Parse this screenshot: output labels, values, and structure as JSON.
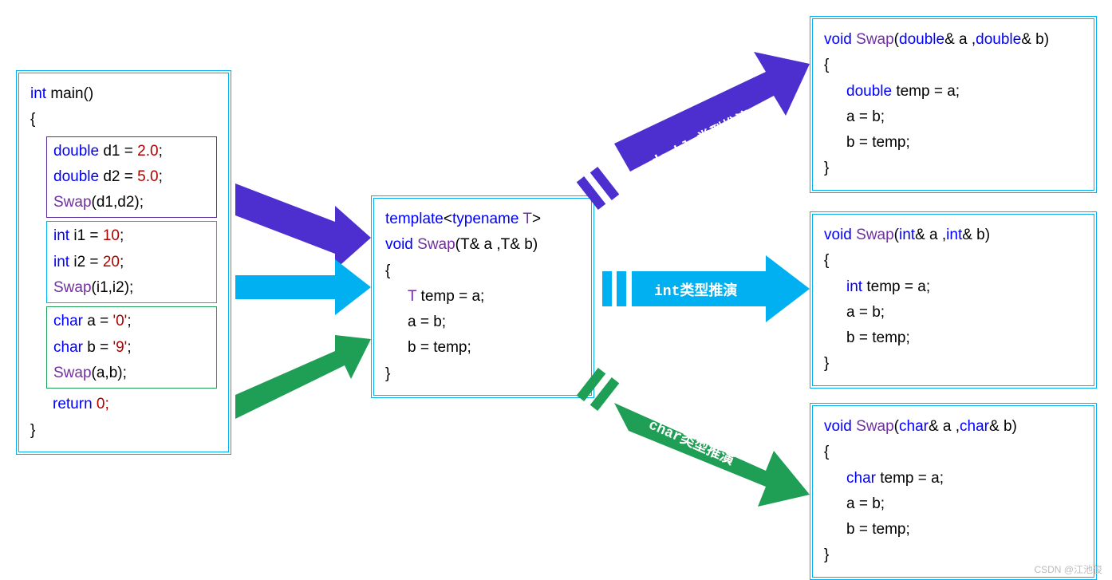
{
  "main": {
    "sig_kw": "int",
    "sig_name": "main",
    "sig_paren": "()",
    "open": "{",
    "double_block": {
      "l1_kw": "double",
      "l1_var": "d1",
      "l1_eq": " = ",
      "l1_val": "2.0",
      "semi": ";",
      "l2_kw": "double",
      "l2_var": "d2",
      "l2_eq": " = ",
      "l2_val": "5.0",
      "l3_call": "Swap",
      "l3_args": "(d1,d2);"
    },
    "int_block": {
      "l1_kw": "int",
      "l1_var": "i1",
      "l1_eq": " = ",
      "l1_val": "10",
      "semi": ";",
      "l2_kw": "int",
      "l2_var": "i2",
      "l2_eq": " = ",
      "l2_val": "20",
      "l3_call": "Swap",
      "l3_args": "(i1,i2);"
    },
    "char_block": {
      "l1_kw": "char",
      "l1_var": "a",
      "l1_eq": " = ",
      "l1_val": "'0'",
      "semi": ";",
      "l2_kw": "char",
      "l2_var": "b",
      "l2_eq": " = ",
      "l2_val": "'9'",
      "l3_call": "Swap",
      "l3_args": "(a,b);"
    },
    "ret_kw": "return",
    "ret_val": " 0;",
    "close": "}"
  },
  "template": {
    "l1_a": "template",
    "l1_b": "<",
    "l1_c": "typename",
    "l1_d": " T",
    "l1_e": ">",
    "l2_kw": "void",
    "l2_name": "Swap",
    "l2_args_a": "(T",
    "l2_args_b": "& a ,T",
    "l2_args_c": "& b)",
    "open": "{",
    "l3_a": "T",
    "l3_b": " temp = a;",
    "l4": "a = b;",
    "l5": "b = temp;",
    "close": "}"
  },
  "inst_double": {
    "sig_kw": "void",
    "sig_name": "Swap",
    "sig_a": "(",
    "sig_t": "double",
    "sig_b": "& a ,",
    "sig_t2": "double",
    "sig_c": "& b)",
    "open": "{",
    "l1_t": "double",
    "l1_rest": " temp = a;",
    "l2": "a = b;",
    "l3": "b = temp;",
    "close": "}"
  },
  "inst_int": {
    "sig_kw": "void",
    "sig_name": "Swap",
    "sig_a": "(",
    "sig_t": "int",
    "sig_b": "& a ,",
    "sig_t2": "int",
    "sig_c": "& b)",
    "open": "{",
    "l1_t": "int",
    "l1_rest": " temp = a;",
    "l2": "a = b;",
    "l3": "b = temp;",
    "close": "}"
  },
  "inst_char": {
    "sig_kw": "void",
    "sig_name": "Swap",
    "sig_a": "(",
    "sig_t": "char",
    "sig_b": "& a ,",
    "sig_t2": "char",
    "sig_c": "& b)",
    "open": "{",
    "l1_t": "char",
    "l1_rest": " temp = a;",
    "l2": "a = b;",
    "l3": "b = temp;",
    "close": "}"
  },
  "arrows": {
    "double_label": "double类型推演",
    "int_label": "int类型推演",
    "char_label": "char类型推演"
  },
  "watermark": "CSDN @江池俊"
}
